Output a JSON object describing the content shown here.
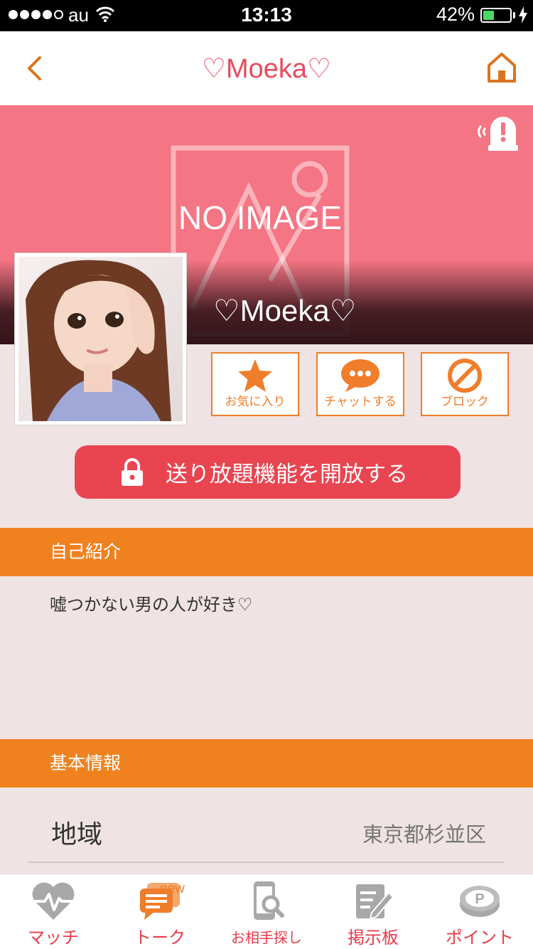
{
  "status_bar": {
    "carrier": "au",
    "time": "13:13",
    "battery": "42%",
    "battery_level": 0.42
  },
  "nav": {
    "title": "♡Moeka♡"
  },
  "cover": {
    "placeholder_text": "NO IMAGE",
    "name": "♡Moeka♡"
  },
  "actions": [
    {
      "label": "お気に入り",
      "icon": "star-icon"
    },
    {
      "label": "チャットする",
      "icon": "chat-bubble-icon"
    },
    {
      "label": "ブロック",
      "icon": "block-icon"
    }
  ],
  "unlock": {
    "label": "送り放題機能を開放する",
    "icon": "lock-icon"
  },
  "intro": {
    "heading": "自己紹介",
    "text": "嘘つかない男の人が好き♡"
  },
  "basic_info": {
    "heading": "基本情報",
    "rows": [
      {
        "label": "地域",
        "value": "東京都杉並区"
      }
    ]
  },
  "tabs": [
    {
      "label": "マッチ",
      "icon": "heart-pulse-icon"
    },
    {
      "label": "トーク",
      "icon": "chat-icon",
      "badge": "new"
    },
    {
      "label": "お相手探し",
      "icon": "phone-search-icon"
    },
    {
      "label": "掲示板",
      "icon": "board-edit-icon"
    },
    {
      "label": "ポイント",
      "icon": "point-coin-icon"
    }
  ],
  "colors": {
    "accent": "#ef821f",
    "title_pink": "#ea4a5e",
    "cover_pink": "#f47583",
    "unlock_red": "#e94550",
    "background": "#efe3e3"
  }
}
